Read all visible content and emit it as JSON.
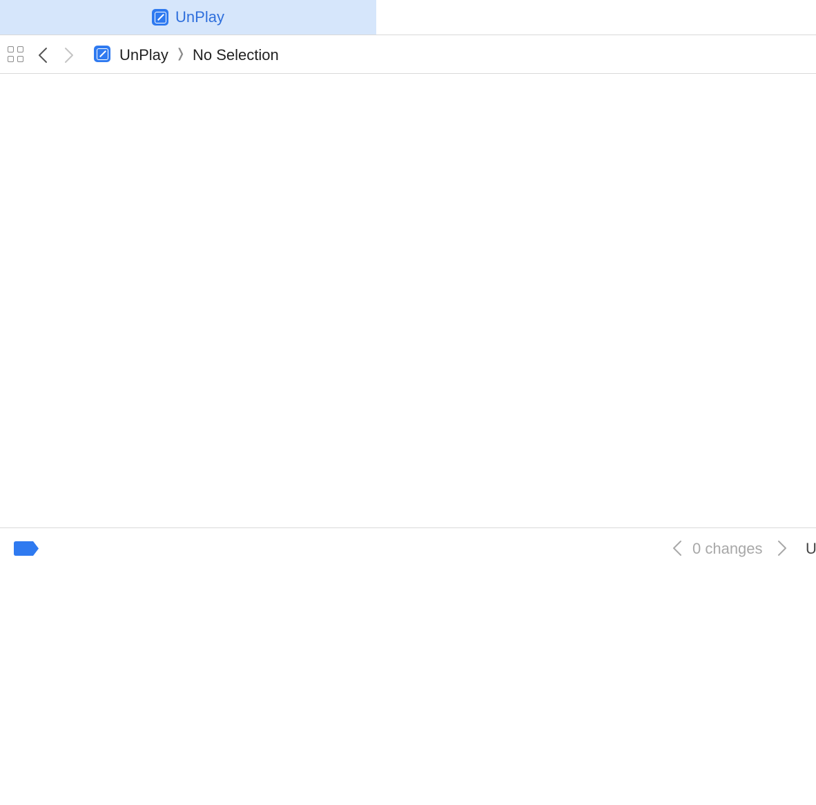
{
  "tabs": [
    {
      "label": "UnPlay",
      "active": true,
      "icon": "app-icon"
    }
  ],
  "jumpbar": {
    "project": "UnPlay",
    "separator": "❭",
    "selection": "No Selection"
  },
  "changes": {
    "count_label": "0 changes",
    "trailing_text": "U"
  },
  "colors": {
    "accent": "#2f7af0",
    "active_tab_bg": "#d6e6fb",
    "active_tab_text": "#2f6fdc",
    "divider": "#d9d9d9"
  }
}
